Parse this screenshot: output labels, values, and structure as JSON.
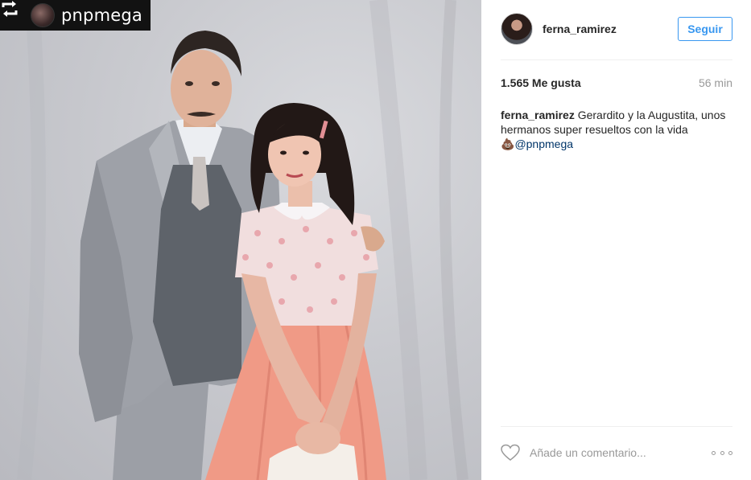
{
  "repost": {
    "icon": "repost-icon",
    "account": "pnpmega"
  },
  "post": {
    "username": "ferna_ramirez",
    "follow_label": "Seguir",
    "likes": "1.565 Me gusta",
    "time": "56 min",
    "caption_user": "ferna_ramirez",
    "caption_text": "Gerardito y la Augustita, unos hermanos super resueltos con la vida",
    "caption_emoji": "💩",
    "caption_mention": "@pnpmega",
    "comment_placeholder": "Añade un comentario...",
    "accent_color": "#3897f0"
  }
}
